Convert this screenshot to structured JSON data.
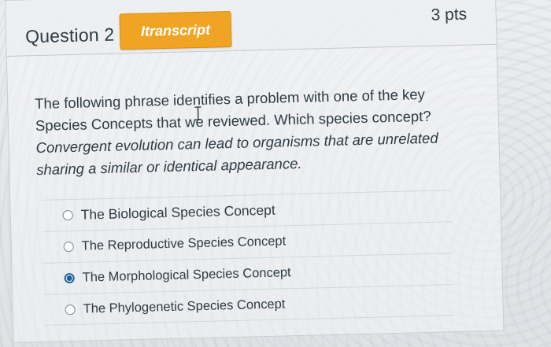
{
  "question": {
    "title": "Question 2",
    "transcript_button": "Itranscript",
    "points": "3 pts",
    "text": "The following phrase identifies a problem with one of the key Species Concepts that we reviewed. Which species concept?",
    "note": "Convergent evolution can lead to organisms that are unrelated sharing a similar or identical appearance."
  },
  "answers": [
    {
      "label": "The Biological Species Concept",
      "selected": false
    },
    {
      "label": "The Reproductive Species Concept",
      "selected": false
    },
    {
      "label": "The Morphological Species Concept",
      "selected": true
    },
    {
      "label": "The Phylogenetic Species Concept",
      "selected": false
    }
  ],
  "colors": {
    "transcript_button": "#f0a424",
    "text": "#2d3b45",
    "radio_selected": "#1f5d99"
  },
  "icons": {
    "cursor": "text-cursor-icon"
  }
}
